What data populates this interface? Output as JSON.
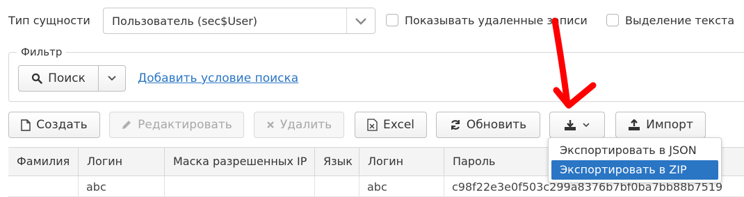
{
  "entity_type": {
    "label": "Тип сущности",
    "value": "Пользователь (sec$User)"
  },
  "options": {
    "show_deleted_label": "Показывать удаленные записи",
    "text_selection_label": "Выделение текста"
  },
  "filter": {
    "legend": "Фильтр",
    "search_label": "Поиск",
    "add_condition_label": "Добавить условие поиска"
  },
  "toolbar": {
    "create_label": "Создать",
    "edit_label": "Редактировать",
    "delete_label": "Удалить",
    "excel_label": "Excel",
    "refresh_label": "Обновить",
    "import_label": "Импорт"
  },
  "export_menu": {
    "items": [
      {
        "label": "Экспортировать в JSON"
      },
      {
        "label": "Экспортировать в ZIP"
      }
    ],
    "active_index": 1
  },
  "table": {
    "columns": [
      "Фамилия",
      "Логин",
      "Маска разрешенных IP",
      "Язык",
      "Логин",
      "Пароль"
    ],
    "rows": [
      {
        "cells": [
          "",
          "abc",
          "",
          "",
          "abc",
          "c98f22e3e0f503c299a8376b7bf0ba7bb88b7519"
        ]
      }
    ]
  },
  "colors": {
    "link": "#2a75c4",
    "menu_active": "#2a75c4",
    "annotation_arrow": "#ff0000"
  }
}
